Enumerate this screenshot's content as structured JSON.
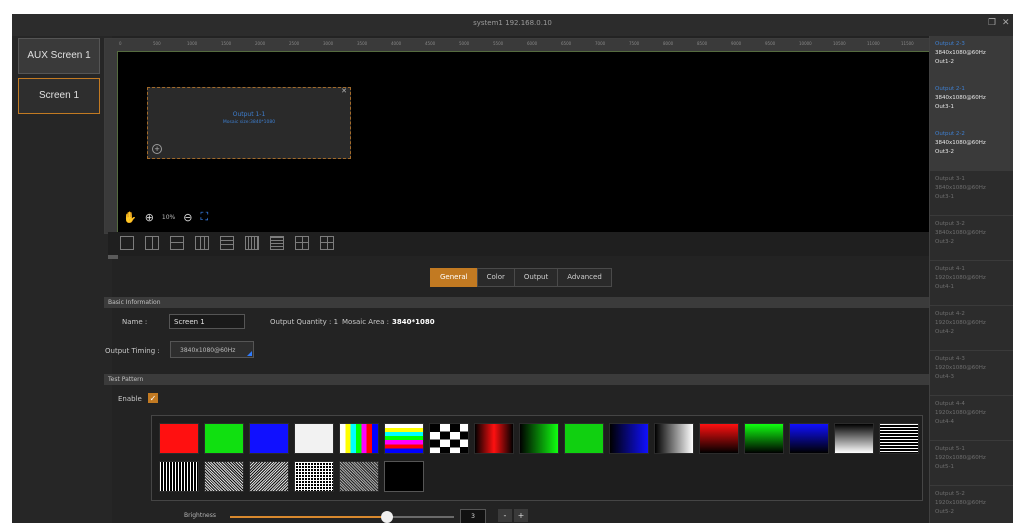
{
  "window": {
    "title": "system1 192.168.0.10"
  },
  "screens": [
    {
      "label": "AUX Screen 1",
      "active": false
    },
    {
      "label": "Screen 1",
      "active": true
    }
  ],
  "canvas": {
    "ruler_ticks": [
      "0",
      "500",
      "1000",
      "1500",
      "2000",
      "2500",
      "3000",
      "3500",
      "4000",
      "4500",
      "5000",
      "5500",
      "6000",
      "6500",
      "7000",
      "7500",
      "8000",
      "8500",
      "9000",
      "9500",
      "10000",
      "10500",
      "11000",
      "11500"
    ],
    "output": {
      "name": "Output 1-1",
      "sub": "Mosaic size:3840*1080"
    },
    "zoom_label": "10%"
  },
  "tabs": [
    "General",
    "Color",
    "Output",
    "Advanced"
  ],
  "basic": {
    "header": "Basic Information",
    "name_label": "Name :",
    "name_value": "Screen 1",
    "qty_label": "Output Quantity : 1",
    "mosaic_label": "Mosaic Area :",
    "mosaic_value": "3840*1080",
    "timing_label": "Output Timing :",
    "timing_value": "3840x1080@60Hz"
  },
  "test": {
    "header": "Test Pattern",
    "enable_label": "Enable",
    "enabled": true
  },
  "brightness": {
    "label": "Brightness",
    "value": "3",
    "level_fraction": 0.7,
    "minus": "-",
    "plus": "+"
  },
  "outputs": [
    {
      "name": "Output 2-3",
      "res": "3840x1080@60Hz",
      "port": "Out1-2",
      "state": "on"
    },
    {
      "name": "Output 2-1",
      "res": "3840x1080@60Hz",
      "port": "Out3-1",
      "state": "on"
    },
    {
      "name": "Output 2-2",
      "res": "3840x1080@60Hz",
      "port": "Out3-2",
      "state": "on"
    },
    {
      "name": "Output 3-1",
      "res": "3840x1080@60Hz",
      "port": "Out3-1",
      "state": "off"
    },
    {
      "name": "Output 3-2",
      "res": "3840x1080@60Hz",
      "port": "Out3-2",
      "state": "off"
    },
    {
      "name": "Output 4-1",
      "res": "1920x1080@60Hz",
      "port": "Out4-1",
      "state": "off"
    },
    {
      "name": "Output 4-2",
      "res": "1920x1080@60Hz",
      "port": "Out4-2",
      "state": "off"
    },
    {
      "name": "Output 4-3",
      "res": "1920x1080@60Hz",
      "port": "Out4-3",
      "state": "off"
    },
    {
      "name": "Output 4-4",
      "res": "1920x1080@60Hz",
      "port": "Out4-4",
      "state": "off"
    },
    {
      "name": "Output 5-1",
      "res": "1920x1080@60Hz",
      "port": "Out5-1",
      "state": "off"
    },
    {
      "name": "Output 5-2",
      "res": "1920x1080@60Hz",
      "port": "Out5-2",
      "state": "off"
    }
  ],
  "colors": {
    "accent": "#c27a22",
    "blue": "#3e7fd0",
    "bg": "#232323"
  }
}
